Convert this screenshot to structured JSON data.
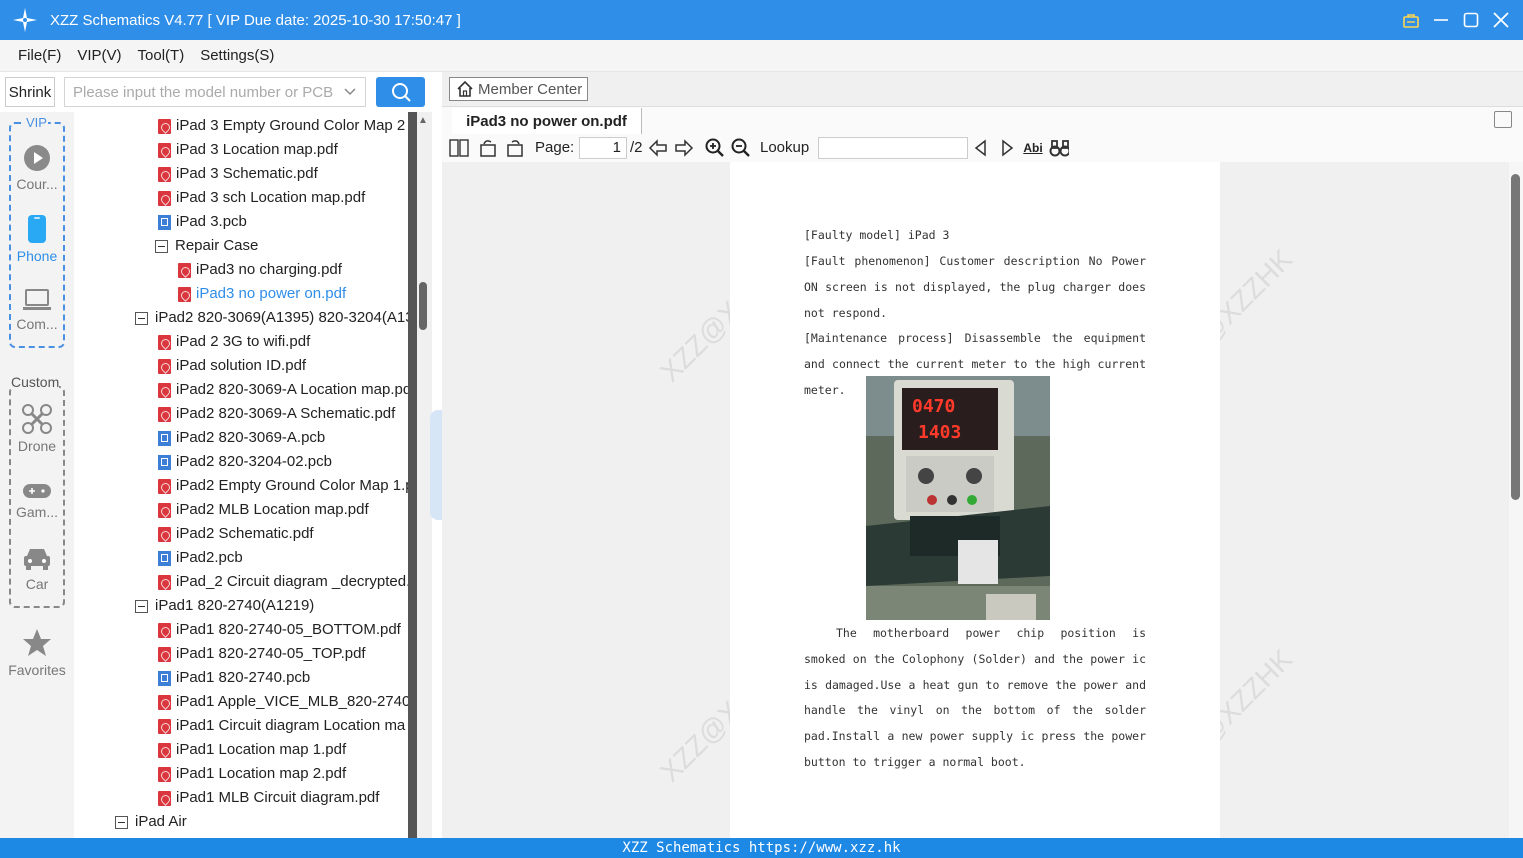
{
  "window": {
    "title": "XZZ Schematics V4.77 [ VIP Due date: 2025-10-30 17:50:47 ]"
  },
  "menu": [
    "File(F)",
    "VIP(V)",
    "Tool(T)",
    "Settings(S)"
  ],
  "search": {
    "shrink_label": "Shrink",
    "placeholder": "Please input the model number or PCB"
  },
  "rail": {
    "vip_label": "VIP",
    "custom_label": "Custom",
    "items": [
      {
        "label": "Cour...",
        "icon": "play-circle-icon"
      },
      {
        "label": "Phone",
        "icon": "phone-icon"
      },
      {
        "label": "Com...",
        "icon": "laptop-icon"
      },
      {
        "label": "Drone",
        "icon": "drone-icon"
      },
      {
        "label": "Gam...",
        "icon": "gamepad-icon"
      },
      {
        "label": "Car",
        "icon": "car-icon"
      },
      {
        "label": "Favorites",
        "icon": "star-icon"
      }
    ]
  },
  "tree": [
    {
      "type": "pdf",
      "label": "iPad 3 Empty Ground Color Map 2"
    },
    {
      "type": "pdf",
      "label": "iPad 3 Location map.pdf"
    },
    {
      "type": "pdf",
      "label": "iPad 3 Schematic.pdf"
    },
    {
      "type": "pdf",
      "label": "iPad 3 sch Location map.pdf"
    },
    {
      "type": "pcb",
      "label": "iPad 3.pcb"
    },
    {
      "type": "folder",
      "label": "Repair Case"
    },
    {
      "type": "pdf",
      "label": "iPad3 no charging.pdf"
    },
    {
      "type": "pdf",
      "label": "iPad3 no power on.pdf",
      "selected": true
    },
    {
      "type": "folder",
      "label": "iPad2 820-3069(A1395) 820-3204(A13"
    },
    {
      "type": "pdf",
      "label": "iPad 2 3G to wifi.pdf"
    },
    {
      "type": "pdf",
      "label": "iPad solution ID.pdf"
    },
    {
      "type": "pdf",
      "label": "iPad2 820-3069-A Location map.pd"
    },
    {
      "type": "pdf",
      "label": "iPad2 820-3069-A Schematic.pdf"
    },
    {
      "type": "pcb",
      "label": "iPad2 820-3069-A.pcb"
    },
    {
      "type": "pcb",
      "label": "iPad2 820-3204-02.pcb"
    },
    {
      "type": "pdf",
      "label": "iPad2 Empty Ground Color Map 1.p"
    },
    {
      "type": "pdf",
      "label": "iPad2 MLB Location map.pdf"
    },
    {
      "type": "pdf",
      "label": "iPad2 Schematic.pdf"
    },
    {
      "type": "pcb",
      "label": "iPad2.pcb"
    },
    {
      "type": "pdf",
      "label": "iPad_2 Circuit diagram _decrypted."
    },
    {
      "type": "folder",
      "label": "iPad1 820-2740(A1219)"
    },
    {
      "type": "pdf",
      "label": "iPad1 820-2740-05_BOTTOM.pdf"
    },
    {
      "type": "pdf",
      "label": "iPad1 820-2740-05_TOP.pdf"
    },
    {
      "type": "pcb",
      "label": "iPad1 820-2740.pcb"
    },
    {
      "type": "pdf",
      "label": "iPad1 Apple_VICE_MLB_820-2740-/"
    },
    {
      "type": "pdf",
      "label": "iPad1 Circuit diagram Location ma"
    },
    {
      "type": "pdf",
      "label": "iPad1 Location map 1.pdf"
    },
    {
      "type": "pdf",
      "label": "iPad1 Location map 2.pdf"
    },
    {
      "type": "pdf",
      "label": "iPad1 MLB Circuit diagram.pdf"
    },
    {
      "type": "folder",
      "label": "iPad Air"
    }
  ],
  "viewer": {
    "member_center": "Member Center",
    "tab_title": "iPad3 no power on.pdf",
    "page_label": "Page:",
    "page_current": "1",
    "page_total": "/2",
    "lookup_label": "Lookup",
    "lookup_value": ""
  },
  "document": {
    "para1": "[Faulty model] iPad 3",
    "para2": "[Fault phenomenon] Customer description No Power ON screen is not displayed, the plug charger does not respond.",
    "para3": "[Maintenance process] Disassemble the equipment and connect the current meter to the high current meter.",
    "para4": "The motherboard power chip position is smoked on the Colophony (Solder) and the power ic is damaged.Use a heat gun to remove the power and handle the vinyl on the bottom of the solder pad.Install a new power supply ic press the power button to trigger a normal boot.",
    "photo_readout_top": "0470",
    "photo_readout_bottom": "1403",
    "watermark": "XZZ@XZZHK"
  },
  "status": "XZZ Schematics https://www.xzz.hk"
}
